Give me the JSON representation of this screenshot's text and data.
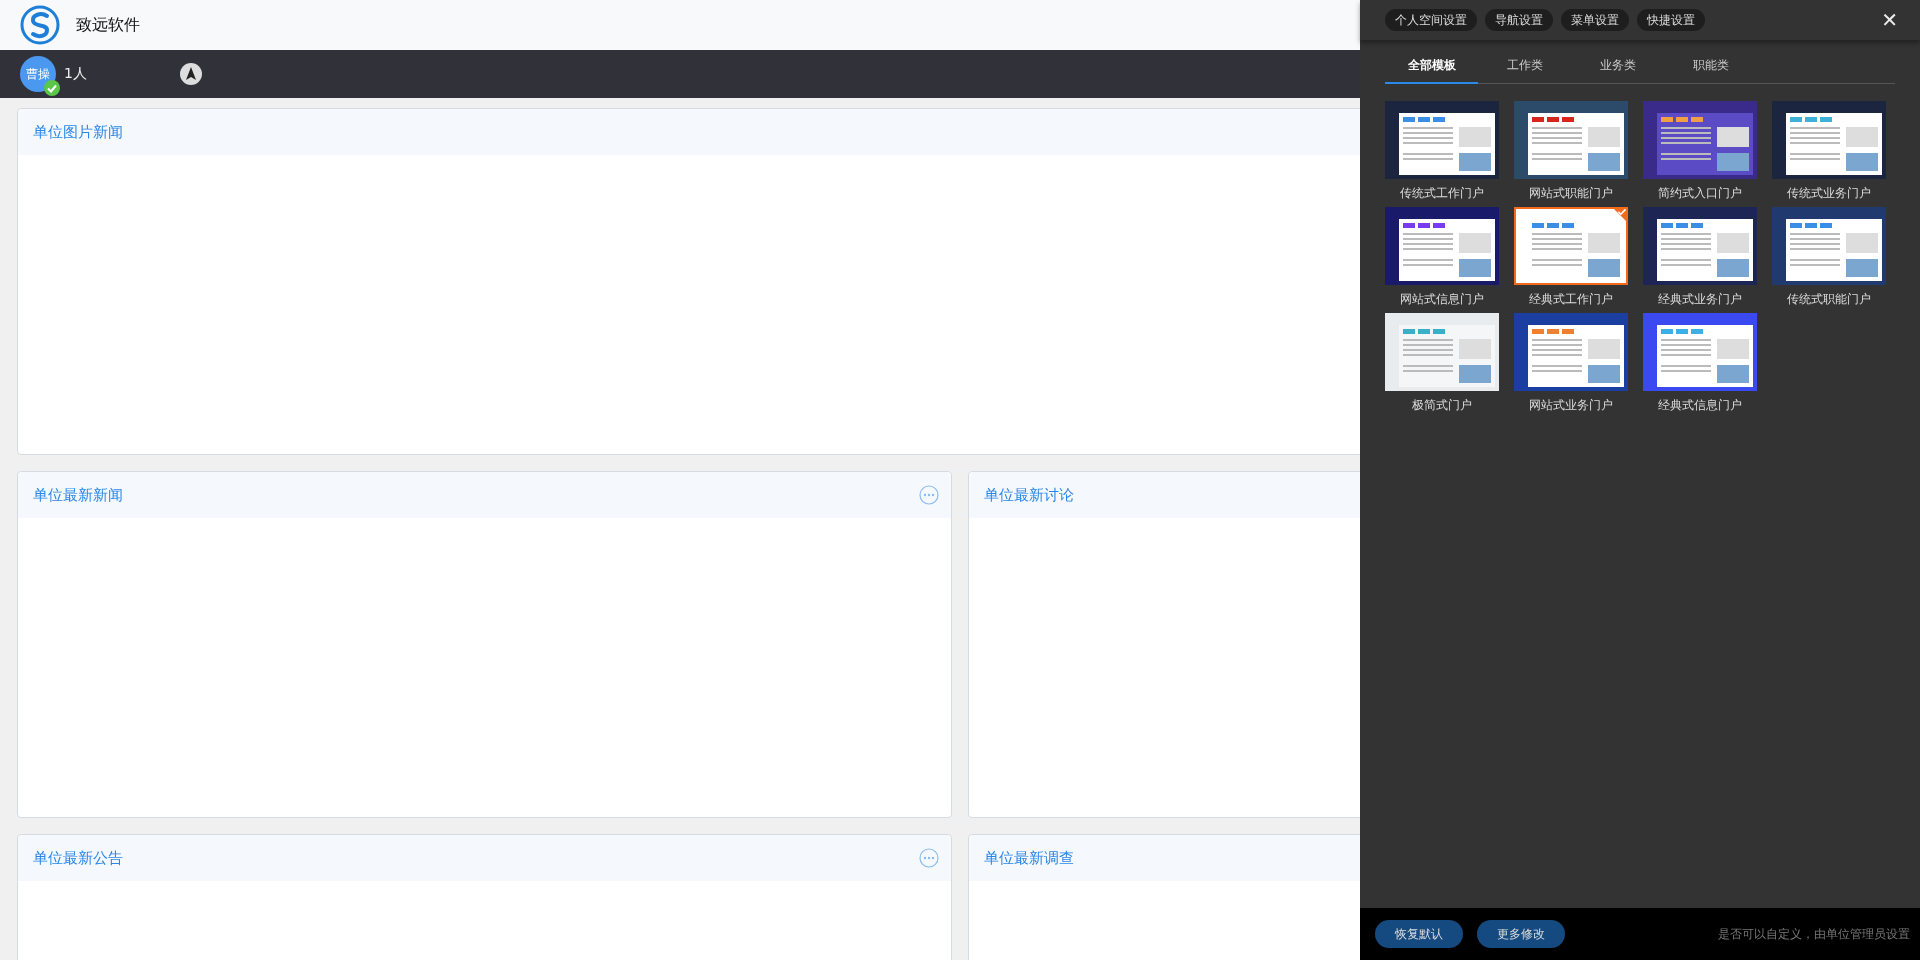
{
  "header": {
    "brand": "致远软件"
  },
  "user_bar": {
    "avatar_text": "曹操",
    "online": true,
    "count": "1人"
  },
  "cards": [
    {
      "title": "单位图片新闻",
      "kind": "wide",
      "more_button": false
    },
    {
      "title": "单位最新新闻",
      "kind": "half",
      "more_button": true
    },
    {
      "title": "单位最新讨论",
      "kind": "half",
      "more_button": false
    },
    {
      "title": "单位最新公告",
      "kind": "half",
      "more_button": true
    },
    {
      "title": "单位最新调查",
      "kind": "half",
      "more_button": false
    }
  ],
  "panel": {
    "top_buttons": [
      "个人空间设置",
      "导航设置",
      "菜单设置",
      "快捷设置"
    ],
    "close": "✕",
    "tabs": [
      {
        "label": "全部模板",
        "selected": true
      },
      {
        "label": "工作类",
        "selected": false
      },
      {
        "label": "业务类",
        "selected": false
      },
      {
        "label": "职能类",
        "selected": false
      }
    ],
    "templates": [
      {
        "label": "传统式工作门户",
        "selected": false
      },
      {
        "label": "网站式职能门户",
        "selected": false
      },
      {
        "label": "简约式入口门户",
        "selected": false
      },
      {
        "label": "传统式业务门户",
        "selected": false
      },
      {
        "label": "网站式信息门户",
        "selected": false
      },
      {
        "label": "经典式工作门户",
        "selected": true
      },
      {
        "label": "经典式业务门户",
        "selected": false
      },
      {
        "label": "传统式职能门户",
        "selected": false
      },
      {
        "label": "极简式门户",
        "selected": false
      },
      {
        "label": "网站式业务门户",
        "selected": false
      },
      {
        "label": "经典式信息门户",
        "selected": false
      }
    ],
    "footer_buttons": [
      "恢复默认",
      "更多修改"
    ],
    "footer_note": "是否可以自定义，由单位管理员设置"
  }
}
